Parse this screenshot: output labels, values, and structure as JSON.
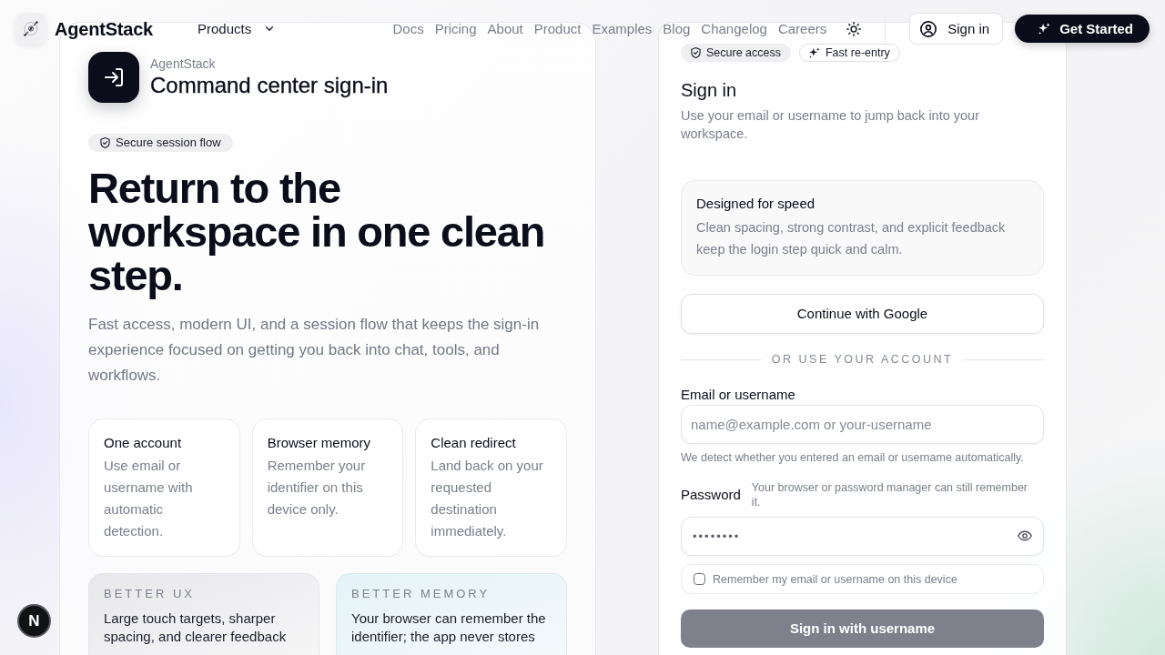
{
  "navbar": {
    "brand": "AgentStack",
    "products_menu": {
      "label": "Products"
    },
    "links": [
      "Docs",
      "Pricing",
      "About",
      "Product",
      "Examples",
      "Blog",
      "Changelog",
      "Careers"
    ],
    "sign_in": {
      "label": "Sign in"
    },
    "get_started": {
      "label": "Get Started"
    }
  },
  "intro": {
    "brand": "AgentStack",
    "title": "Command center sign-in",
    "chip": {
      "label": "Secure session flow",
      "kind": "filled"
    },
    "headline": "Return to the workspace in one clean step.",
    "lead": "Fast access, modern UI, and a session flow that keeps the sign-in experience focused on getting you back into chat, tools, and workflows.",
    "features": [
      {
        "title": "One account",
        "text": "Use email or username with automatic detection."
      },
      {
        "title": "Browser memory",
        "text": "Remember your identifier on this device only."
      },
      {
        "title": "Clean redirect",
        "text": "Land back on your requested destination immediately."
      }
    ],
    "highlights": [
      {
        "kind": "neutral",
        "label": "BETTER UX",
        "text": "Large touch targets, sharper spacing, and clearer feedback"
      },
      {
        "kind": "info",
        "label": "BETTER MEMORY",
        "text": "Your browser can remember the identifier; the app never stores"
      }
    ]
  },
  "sign_in_panel": {
    "chips": [
      {
        "label": "Secure access",
        "kind": "filled"
      },
      {
        "label": "Fast re-entry",
        "kind": "outline"
      }
    ],
    "title": "Sign in",
    "subtitle": "Use your email or username to jump back into your workspace.",
    "note": {
      "title": "Designed for speed",
      "text": "Clean spacing, strong contrast, and explicit feedback keep the login step quick and calm."
    },
    "google_button": "Continue with Google",
    "divider": "OR USE YOUR ACCOUNT",
    "fields": [
      {
        "kind": "text",
        "label": "Email or username",
        "placeholder": "name@example.com or your-username",
        "help": "We detect whether you entered an email or username automatically."
      },
      {
        "kind": "password",
        "label": "Password",
        "hint": "Your browser or password manager can still remember it.",
        "value": "••••••••"
      }
    ],
    "remember": {
      "label": "Remember my email or username on this device",
      "checked": false
    },
    "submit": {
      "label": "Sign in with username",
      "disabled": true
    }
  },
  "dev_badge": "N"
}
